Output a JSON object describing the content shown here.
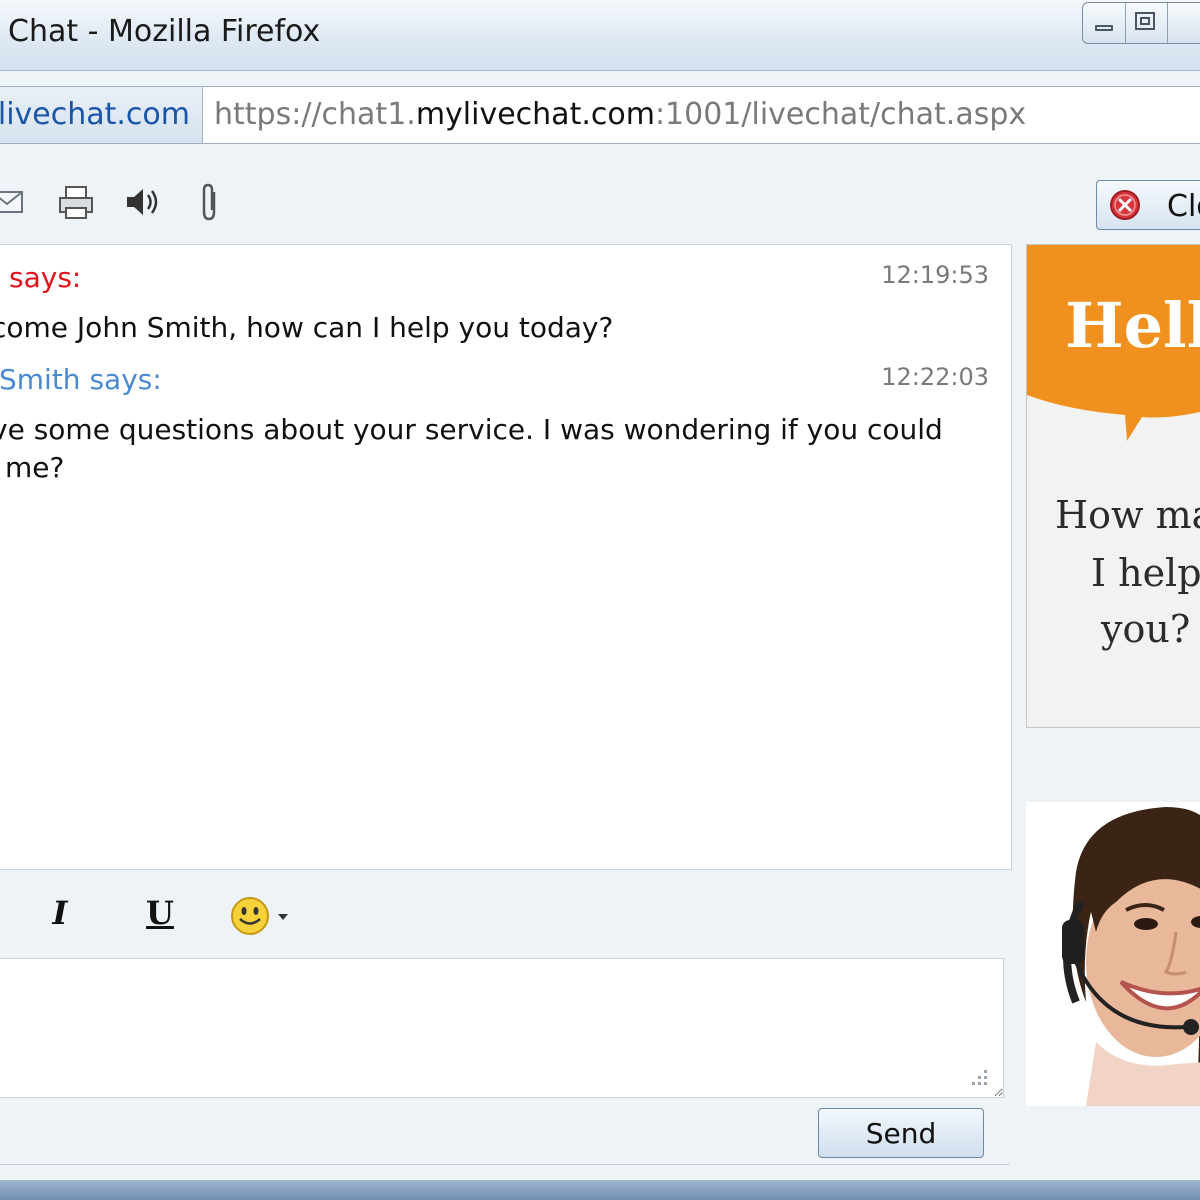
{
  "window": {
    "title": "Chat - Mozilla Firefox"
  },
  "address_bar": {
    "site_identity": "mylivechat.com",
    "url_prefix": "https://chat1.",
    "url_host": "mylivechat.com",
    "url_suffix": ":1001/livechat/chat.aspx"
  },
  "toolbar": {
    "icons": [
      "email-icon",
      "print-icon",
      "speaker-icon",
      "paperclip-icon"
    ],
    "close_label": "Close"
  },
  "chat": {
    "messages": [
      {
        "sender": "says:",
        "sender_color": "#e0131b",
        "time": "12:19:53",
        "text": "come John Smith, how can I help you today?"
      },
      {
        "sender": "Smith says:",
        "sender_color": "#4b8ad0",
        "time": "12:22:03",
        "text_line1": "ve some questions about your service. I was wondering if you could",
        "text_line2": "me?"
      }
    ]
  },
  "ad": {
    "hello": "Hello",
    "line1": "How may",
    "line2": "I help",
    "line3": "you?",
    "bubble_color": "#f0911f"
  },
  "format": {
    "italic": "I",
    "underline": "U",
    "emoticon": "smiley-icon"
  },
  "input": {
    "value": ""
  },
  "send_label": "Send"
}
